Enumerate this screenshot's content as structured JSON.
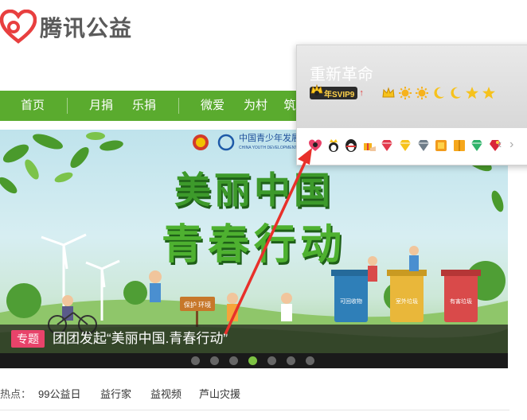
{
  "logo": {
    "text": "腾讯公益",
    "color": "#e83f3f"
  },
  "nav": {
    "items": [
      {
        "label": "首页"
      },
      {
        "label": "月捐"
      },
      {
        "label": "乐捐"
      },
      {
        "label": "微爱"
      },
      {
        "label": "为村"
      },
      {
        "label": "筑"
      }
    ],
    "background": "#5aab2e"
  },
  "banner": {
    "top_logo_text": "中国青少年发展",
    "top_logo_sub": "CHINA YOUTH DEVELOPMENT",
    "title_line1": "美丽中国",
    "title_line2": "青春行动",
    "sign_text": "保护 环境",
    "bins": [
      "可回收物",
      "室外垃圾",
      "有害垃圾"
    ],
    "caption_tag": "专题",
    "caption_text": "团团发起“美丽中国.青春行动”",
    "dots_count": 7,
    "active_dot": 4
  },
  "hot": {
    "label": "热点：",
    "items": [
      "99公益日",
      "益行家",
      "益视频",
      "芦山灾援"
    ]
  },
  "profile_card": {
    "name": "重新革命",
    "vip_badge": "年SVIP9",
    "vip_arrow": "↑",
    "level_icons": [
      "crown-icon",
      "sun-icon",
      "sun-icon",
      "moon-icon",
      "moon-icon",
      "star-icon",
      "star-icon"
    ],
    "feature_icons": [
      "heart-qq-icon",
      "penguin-vip-icon",
      "qq-penguin-icon",
      "gift-hand-icon",
      "red-diamond-icon",
      "yellow-diamond-icon",
      "gray-diamond-icon",
      "orange-box-icon",
      "book-icon",
      "green-diamond-icon",
      "red-gem-icon"
    ],
    "prev": "‹",
    "next": "›"
  }
}
